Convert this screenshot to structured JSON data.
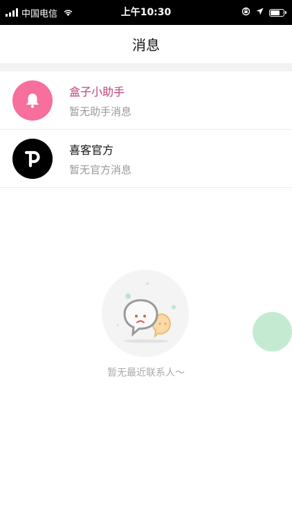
{
  "status_bar": {
    "carrier": "中国电信",
    "time": "上午10:30",
    "battery_level": 0.7
  },
  "nav": {
    "title": "消息"
  },
  "messages": [
    {
      "title": "盒子小助手",
      "subtitle": "暂无助手消息",
      "title_color": "#c0407a",
      "avatar_color": "#f76f9c",
      "icon": "bell-icon"
    },
    {
      "title": "喜客官方",
      "subtitle": "暂无官方消息",
      "title_color": "#111111",
      "avatar_color": "#000000",
      "icon": "p-logo-icon"
    }
  ],
  "empty_state": {
    "text": "暂无最近联系人～"
  },
  "colors": {
    "float_button": "#c4ebd2",
    "accent": "#c0407a"
  }
}
